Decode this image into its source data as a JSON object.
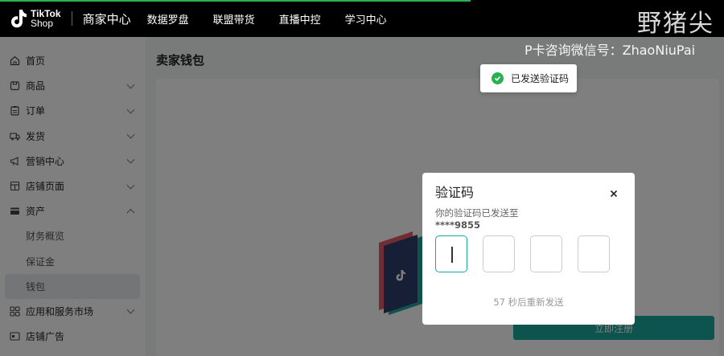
{
  "topbar": {
    "logo_line1": "TikTok",
    "logo_line2": "Shop",
    "brand_title": "商家中心",
    "nav": [
      "数据罗盘",
      "联盟带货",
      "直播中控",
      "学习中心"
    ],
    "watermark": "野猪尖",
    "accent_line_color": "#2ab04f"
  },
  "watermark_sub": "P卡咨询微信号：ZhaoNiuPai",
  "sidebar": {
    "items": [
      {
        "label": "首页",
        "icon": "home-icon"
      },
      {
        "label": "商品",
        "icon": "product-icon",
        "expandable": true
      },
      {
        "label": "订单",
        "icon": "order-icon",
        "expandable": true
      },
      {
        "label": "发货",
        "icon": "truck-icon",
        "expandable": true
      },
      {
        "label": "营销中心",
        "icon": "megaphone-icon",
        "expandable": true
      },
      {
        "label": "店铺页面",
        "icon": "store-icon",
        "expandable": true
      },
      {
        "label": "资产",
        "icon": "wallet-icon",
        "expanded": true
      },
      {
        "label": "财务概览",
        "sub": true
      },
      {
        "label": "保证金",
        "sub": true
      },
      {
        "label": "钱包",
        "sub": true,
        "active": true
      },
      {
        "label": "应用和服务市场",
        "icon": "apps-icon",
        "expandable": true
      },
      {
        "label": "店铺广告",
        "icon": "ad-icon"
      }
    ]
  },
  "main": {
    "page_title": "卖家钱包",
    "register_button": "立即注册"
  },
  "toast": {
    "text": "已发送验证码",
    "icon": "check-circle-icon"
  },
  "modal": {
    "title": "验证码",
    "description": "你的验证码已发送至",
    "phone": "****9855",
    "code_boxes": 4,
    "resend_text": "57 秒后重新发送",
    "accent_color": "#1aa79c"
  }
}
